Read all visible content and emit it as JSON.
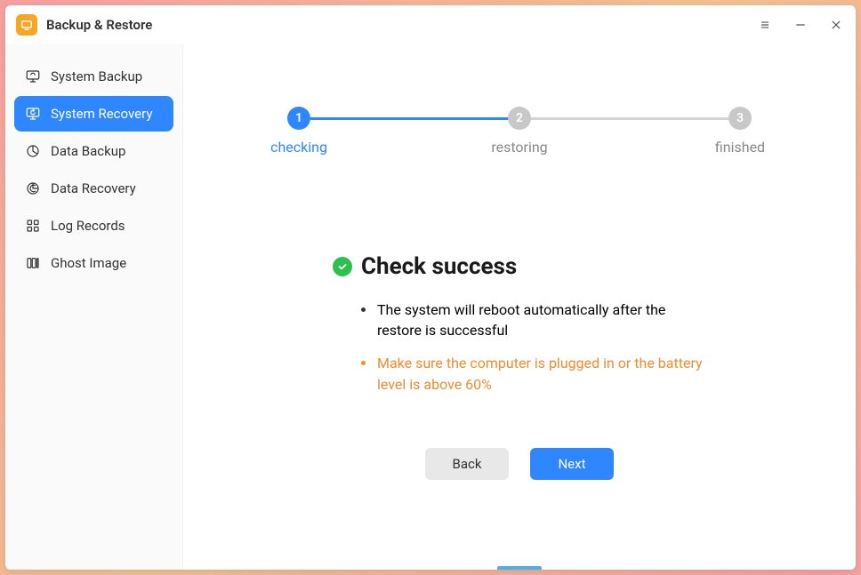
{
  "app": {
    "title": "Backup & Restore"
  },
  "sidebar": {
    "items": [
      {
        "label": "System Backup",
        "icon": "monitor-refresh-icon",
        "active": false
      },
      {
        "label": "System Recovery",
        "icon": "monitor-recover-icon",
        "active": true
      },
      {
        "label": "Data Backup",
        "icon": "pie-icon",
        "active": false
      },
      {
        "label": "Data Recovery",
        "icon": "pie-refresh-icon",
        "active": false
      },
      {
        "label": "Log Records",
        "icon": "grid-icon",
        "active": false
      },
      {
        "label": "Ghost Image",
        "icon": "columns-icon",
        "active": false
      }
    ]
  },
  "stepper": {
    "steps": [
      {
        "num": "1",
        "label": "checking",
        "active": true
      },
      {
        "num": "2",
        "label": "restoring",
        "active": false
      },
      {
        "num": "3",
        "label": "finished",
        "active": false
      }
    ]
  },
  "result": {
    "title": "Check success",
    "bullets": [
      {
        "text": "The system will reboot automatically after the restore is successful",
        "warn": false
      },
      {
        "text": "Make sure the computer is plugged in or the battery level is above 60%",
        "warn": true
      }
    ]
  },
  "buttons": {
    "back": "Back",
    "next": "Next"
  }
}
